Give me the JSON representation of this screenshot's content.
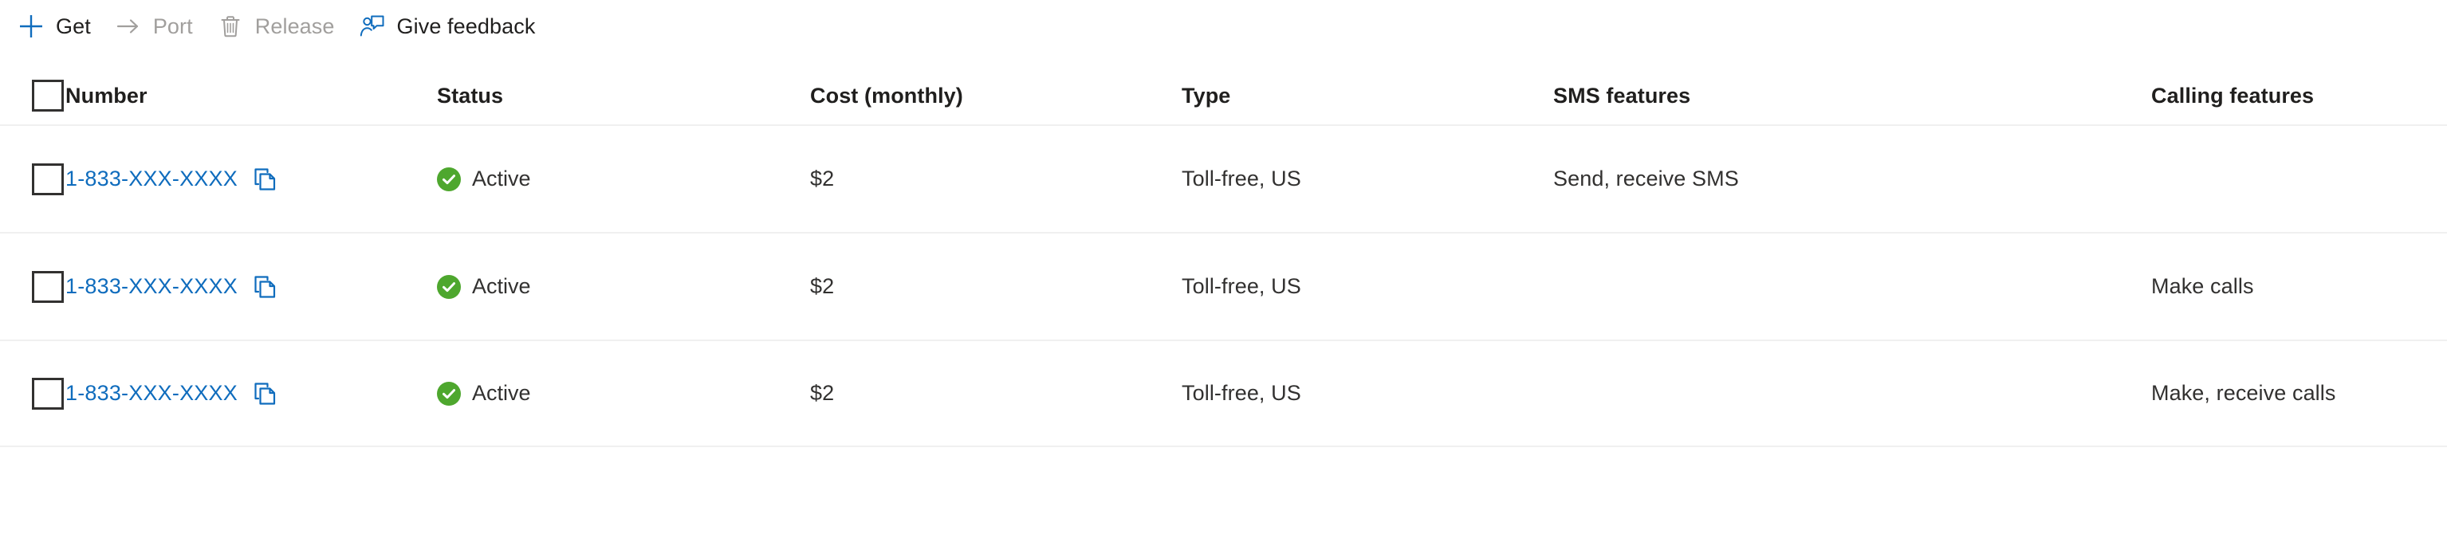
{
  "colors": {
    "accent_blue": "#0f6cbd",
    "text_primary": "#201f1e",
    "text_secondary": "#323130",
    "disabled_grey": "#a19f9d",
    "status_green": "#4ea72e",
    "row_divider": "#f0f0f0"
  },
  "command_bar": {
    "items": [
      {
        "label": "Get",
        "icon": "plus-icon",
        "state": "enabled"
      },
      {
        "label": "Port",
        "icon": "arrow-right-icon",
        "state": "disabled"
      },
      {
        "label": "Release",
        "icon": "trash-icon",
        "state": "disabled"
      },
      {
        "label": "Give feedback",
        "icon": "person-feedback-icon",
        "state": "enabled"
      }
    ]
  },
  "table": {
    "select_all": {
      "checked": false
    },
    "columns": [
      {
        "key": "number",
        "label": "Number"
      },
      {
        "key": "status",
        "label": "Status"
      },
      {
        "key": "cost",
        "label": "Cost (monthly)"
      },
      {
        "key": "type",
        "label": "Type"
      },
      {
        "key": "sms",
        "label": "SMS features"
      },
      {
        "key": "calling",
        "label": "Calling features"
      }
    ],
    "rows": [
      {
        "checked": false,
        "number": "1-833-XXX-XXXX",
        "copy_icon": "copy-icon",
        "status": "Active",
        "status_icon": "check-circle-icon",
        "cost": "$2",
        "type": "Toll-free, US",
        "sms": "Send, receive SMS",
        "calling": ""
      },
      {
        "checked": false,
        "number": "1-833-XXX-XXXX",
        "copy_icon": "copy-icon",
        "status": "Active",
        "status_icon": "check-circle-icon",
        "cost": "$2",
        "type": "Toll-free, US",
        "sms": "",
        "calling": "Make calls"
      },
      {
        "checked": false,
        "number": "1-833-XXX-XXXX",
        "copy_icon": "copy-icon",
        "status": "Active",
        "status_icon": "check-circle-icon",
        "cost": "$2",
        "type": "Toll-free, US",
        "sms": "",
        "calling": "Make, receive calls"
      }
    ]
  }
}
